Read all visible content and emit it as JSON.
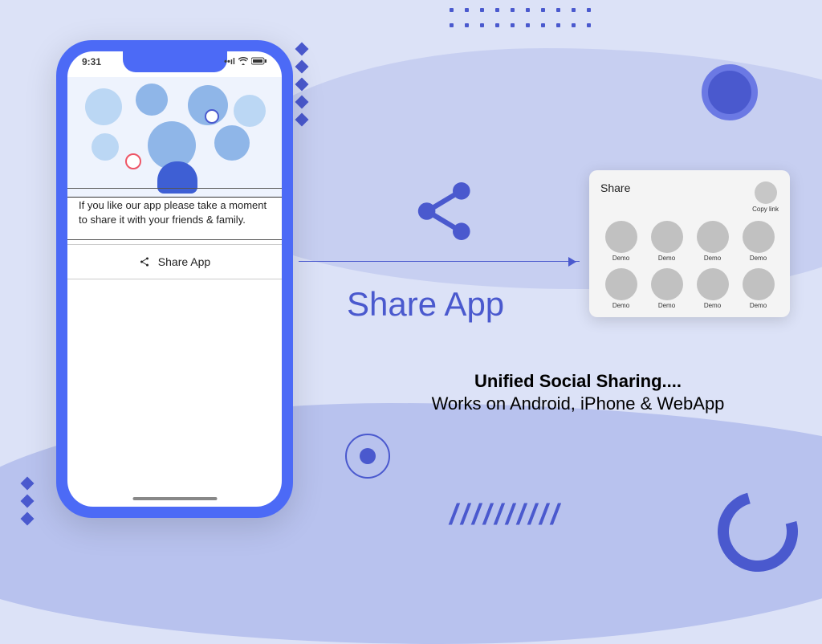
{
  "phone": {
    "time": "9:31",
    "message": "If you like our app please take a moment to share it with your friends & family.",
    "share_button": "Share App"
  },
  "center": {
    "title": "Share App"
  },
  "panel": {
    "heading": "Share",
    "copy_link": "Copy link",
    "items": [
      "Demo",
      "Demo",
      "Demo",
      "Demo",
      "Demo",
      "Demo",
      "Demo",
      "Demo"
    ]
  },
  "caption": {
    "line1": "Unified Social Sharing....",
    "line2": "Works on Android, iPhone & WebApp"
  },
  "hash_deco": "//////////"
}
